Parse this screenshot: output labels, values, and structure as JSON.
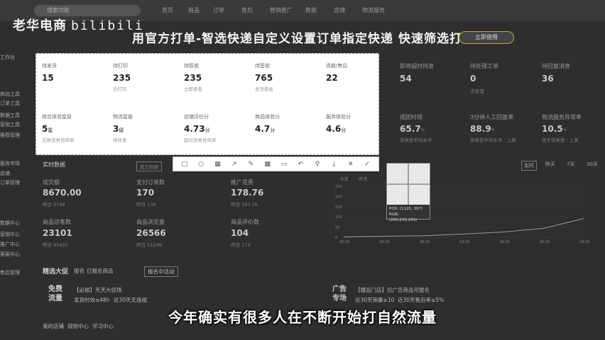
{
  "topbar": {
    "search_placeholder": "搜索功能",
    "nav": [
      "首页",
      "商品",
      "订单",
      "售后",
      "营销推广",
      "数据",
      "店铺",
      "物流服务"
    ]
  },
  "brand": {
    "name": "老华电商",
    "bili": "bilibili"
  },
  "banner": {
    "title": "用官方打单-智选快递自定义设置订单指定快递 快速筛选打印",
    "button": "立即使用"
  },
  "sidebar": [
    "工作台",
    "商品工具",
    "订单工具",
    "数据工具",
    "营销工具",
    "推荐管理",
    "服务市场",
    "店铺",
    "订单管理",
    "数据中心",
    "营销中心",
    "推广中心",
    "客服中心",
    "售后管理"
  ],
  "panel": {
    "header": "实时数据",
    "row1": [
      {
        "label": "待发货",
        "value": "15",
        "sub": ""
      },
      {
        "label": "待打印",
        "value": "235",
        "sub": "去打印"
      },
      {
        "label": "待揽收",
        "value": "235",
        "sub": "立即查看"
      },
      {
        "label": "待签收",
        "value": "765",
        "sub": "发货看板"
      },
      {
        "label": "退款/售后",
        "value": "22",
        "sub": ""
      }
    ],
    "row2": [
      {
        "label": "综合体验星级",
        "value": "5",
        "unit": "星",
        "sub": "击败该类目商家"
      },
      {
        "label": "物流星级",
        "value": "3",
        "unit": "级",
        "sub": "待改善"
      },
      {
        "label": "店铺评价分",
        "value": "4.73",
        "unit": "分",
        "sub": "超过该类目商家"
      },
      {
        "label": "商品体验分",
        "value": "4.7",
        "unit": "分",
        "sub": ""
      },
      {
        "label": "服务体验分",
        "value": "4.6",
        "unit": "分",
        "sub": ""
      }
    ]
  },
  "right_metrics_row1": [
    {
      "label": "即将超时待发",
      "value": "54"
    },
    {
      "label": "待处理工单",
      "value": "0",
      "sub": "去处理"
    },
    {
      "label": "待回复消息",
      "value": "36"
    }
  ],
  "right_metrics_row2": [
    {
      "label": "成团时效",
      "value": "65.7",
      "unit": "%",
      "sub": "该类目平均水平"
    },
    {
      "label": "3分钟人工回复率",
      "value": "88.9",
      "unit": "%",
      "sub": "该类目平均水平 · 上周"
    },
    {
      "label": "物流服务异常率",
      "value": "10.5",
      "unit": "%",
      "sub": "优于该类目 · 上周"
    }
  ],
  "realtime": {
    "title": "实时数据",
    "select": "成交数据",
    "metrics": [
      {
        "label": "成交额",
        "value": "8670.00",
        "sub": "昨日 5768"
      },
      {
        "label": "支付订单数",
        "value": "170",
        "sub": "昨日 134"
      },
      {
        "label": "推广花费",
        "value": "178.76",
        "sub": "昨日 197.76"
      },
      {
        "label": "商品访客数",
        "value": "23101",
        "sub": "昨日 45425"
      },
      {
        "label": "商品浏览量",
        "value": "26566",
        "sub": "昨日 51249"
      },
      {
        "label": "商品评价数",
        "value": "104",
        "sub": "昨日 174"
      }
    ]
  },
  "time_tabs": [
    "实时",
    "昨天",
    "7天",
    "30天"
  ],
  "chart_data": {
    "type": "line",
    "x": [
      "00:00",
      "04:00",
      "08:00",
      "12:00",
      "16:00",
      "20:00",
      "24:00"
    ],
    "y_ticks": [
      0,
      50,
      100,
      150,
      200,
      250
    ],
    "series": [
      {
        "values": [
          2,
          5,
          8,
          16,
          26,
          44,
          92
        ]
      }
    ],
    "legend": [
      "今天",
      "昨天"
    ],
    "ylim": [
      0,
      250
    ]
  },
  "magnifier": {
    "pos": "POS: (1120, 397)",
    "rgb": "RGB: (255,255,255)"
  },
  "toolbar": {
    "tools": [
      "rect-tool-icon",
      "circle-tool-icon",
      "mosaic-icon",
      "arrow-icon",
      "pen-icon",
      "blur-icon",
      "text-icon",
      "undo-icon",
      "pin-icon",
      "save-icon",
      "close-icon",
      "confirm-icon"
    ],
    "glyphs": [
      "□",
      "○",
      "▦",
      "↗",
      "✎",
      "▩",
      "▭",
      "↶",
      "⚲",
      "⤓",
      "✕",
      "✓"
    ]
  },
  "promo": {
    "title": "精选大促",
    "tabs": [
      "报名",
      "已报名商品",
      "报名中活动"
    ],
    "left_title": "免费流量",
    "left_text": "【必报】天天大促场",
    "left_items": [
      "发货时效≤48h",
      "近30天无违规"
    ],
    "right_title": "广告专场",
    "right_text": "【爆品门店】仅广告商品可报名",
    "right_items": [
      "近30天销量≥10",
      "近30天售后率≤5%"
    ]
  },
  "bottom_links": [
    "我的店铺",
    "规则中心",
    "学习中心",
    "平台公告",
    "商家社区"
  ],
  "subtitle": "今年确实有很多人在不断开始打自然流量"
}
